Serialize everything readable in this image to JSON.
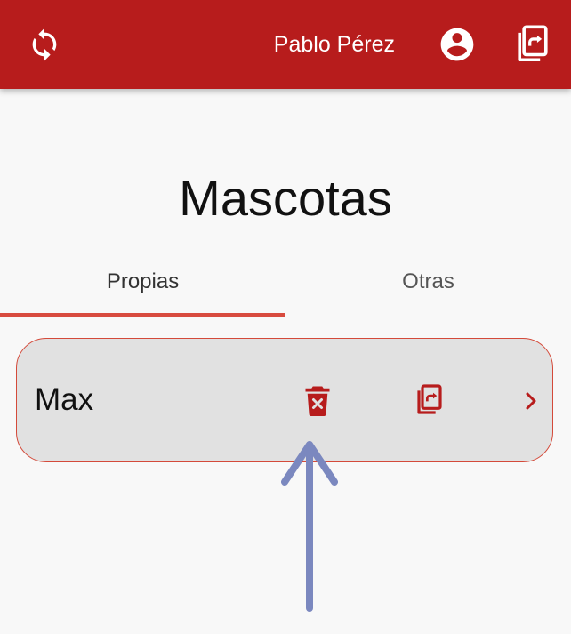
{
  "app_bar": {
    "user_name": "Pablo Pérez",
    "icons": {
      "sync": "sync-icon",
      "account": "account-circle-icon",
      "share": "share-document-icon"
    },
    "background_color": "#b71c1c"
  },
  "page": {
    "title": "Mascotas"
  },
  "tabs": [
    {
      "label": "Propias",
      "selected": true
    },
    {
      "label": "Otras",
      "selected": false
    }
  ],
  "pets": [
    {
      "name": "Max",
      "icons": [
        "delete-icon",
        "share-document-icon",
        "chevron-right-icon"
      ]
    }
  ],
  "colors": {
    "accent": "#b71c1c",
    "tab_indicator": "#d84b3f",
    "card_border": "#d44a3a",
    "card_background": "#e1e1e1",
    "annotation_arrow": "#7b88bf"
  }
}
